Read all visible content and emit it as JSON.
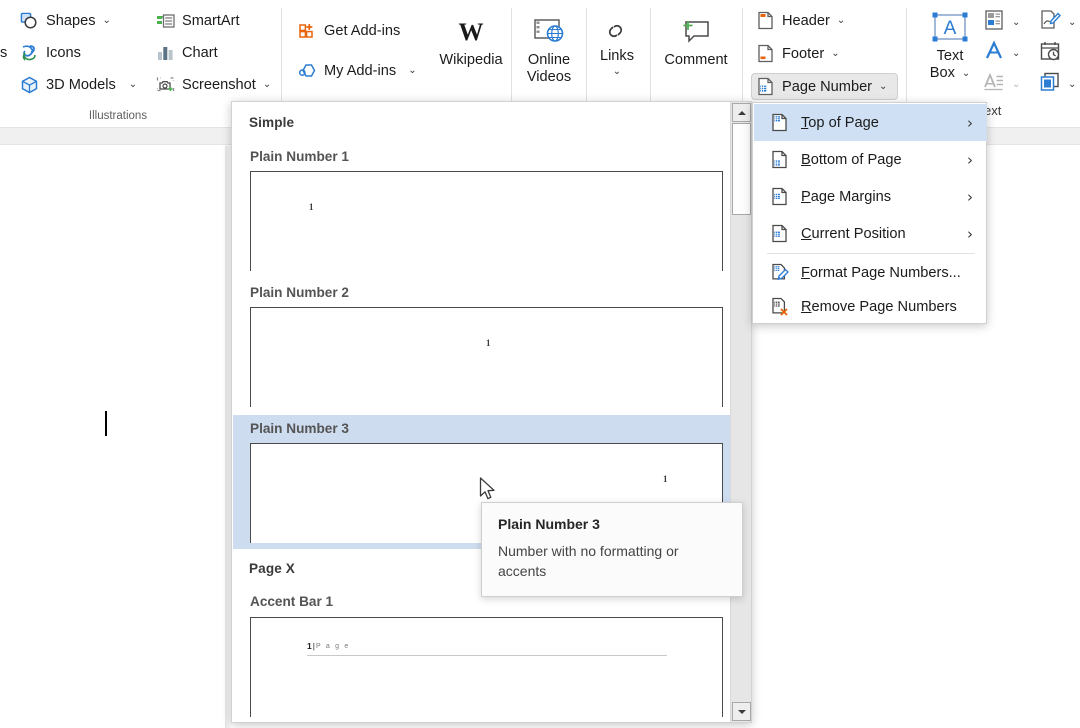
{
  "ribbon": {
    "groups": [
      {
        "name": "illustrations",
        "label": "Illustrations"
      }
    ],
    "illustrations": {
      "shapes": {
        "label": "Shapes",
        "icon": "shapes-icon",
        "chevron": "⌄"
      },
      "icons": {
        "label": "Icons",
        "icon": "icons-icon"
      },
      "models3d": {
        "label": "3D Models",
        "icon": "3d-model-icon",
        "chevron": "⌄"
      },
      "smartart": {
        "label": "SmartArt",
        "icon": "smartart-icon"
      },
      "chart": {
        "label": "Chart",
        "icon": "chart-icon"
      },
      "screenshot": {
        "label": "Screenshot",
        "icon": "screenshot-icon",
        "chevron": "⌄"
      },
      "group_label": "Illustrations"
    },
    "addins": {
      "get_addins": {
        "label": "Get Add-ins",
        "icon": "get-addins-icon"
      },
      "my_addins": {
        "label": "My Add-ins",
        "icon": "my-addins-icon",
        "chevron": "⌄"
      }
    },
    "media": {
      "wikipedia": {
        "label": "Wikipedia",
        "icon": "wikipedia-icon"
      },
      "online_videos": {
        "label_line1": "Online",
        "label_line2": "Videos",
        "icon": "online-videos-icon"
      }
    },
    "links_group": {
      "links": {
        "label": "Links",
        "icon": "links-icon",
        "chevron": "⌄"
      }
    },
    "comments_group": {
      "comment": {
        "label": "Comment",
        "icon": "comment-icon"
      }
    },
    "header_footer": {
      "header": {
        "label": "Header",
        "icon": "header-icon",
        "chevron": "⌄"
      },
      "footer": {
        "label": "Footer",
        "icon": "footer-icon",
        "chevron": "⌄"
      },
      "page_number": {
        "label": "Page Number",
        "icon": "page-number-icon",
        "chevron": "⌄",
        "state": "pressed"
      }
    },
    "text_group": {
      "text_box": {
        "label_line1": "Text",
        "label_line2": "Box",
        "icon": "text-box-icon",
        "chevron": "⌄"
      },
      "quick_parts": {
        "icon": "quick-parts-icon",
        "chevron": "⌄"
      },
      "word_art": {
        "icon": "word-art-icon",
        "chevron": "⌄"
      },
      "drop_cap": {
        "icon": "drop-cap-icon",
        "chevron": "⌄"
      },
      "signature_line": {
        "icon": "signature-line-icon",
        "chevron": "⌄"
      },
      "date_time": {
        "icon": "date-time-icon"
      },
      "object": {
        "icon": "object-icon",
        "chevron": "⌄"
      },
      "clipped_label": "ext"
    }
  },
  "gallery": {
    "name": "page-number-gallery",
    "sections": [
      {
        "heading": "Simple"
      },
      {
        "heading": "Page X"
      }
    ],
    "items": [
      {
        "label": "Plain Number 1",
        "preview_number": "1",
        "align": "left",
        "selected": false
      },
      {
        "label": "Plain Number 2",
        "preview_number": "1",
        "align": "center",
        "selected": false
      },
      {
        "label": "Plain Number 3",
        "preview_number": "1",
        "align": "right",
        "selected": true
      },
      {
        "label": "Accent Bar 1",
        "accent_number": "1",
        "accent_sep": "|",
        "accent_word": "P a g e",
        "selected": false
      }
    ],
    "scrollbar": {
      "up_arrow": "▲",
      "down_arrow": "▼"
    }
  },
  "menu": {
    "name": "page-number-menu",
    "items": [
      {
        "label": "Top of Page",
        "accel": "T",
        "icon": "page-top-number-icon",
        "submenu": true,
        "highlighted": true
      },
      {
        "label": "Bottom of Page",
        "accel": "B",
        "icon": "page-bottom-number-icon",
        "submenu": true,
        "highlighted": false
      },
      {
        "label": "Page Margins",
        "accel": "P",
        "icon": "page-margins-number-icon",
        "submenu": true,
        "highlighted": false
      },
      {
        "label": "Current Position",
        "accel": "C",
        "icon": "current-position-number-icon",
        "submenu": true,
        "highlighted": false
      },
      {
        "label": "Format Page Numbers...",
        "accel": "F",
        "icon": "format-page-numbers-icon",
        "submenu": false,
        "highlighted": false
      },
      {
        "label": "Remove Page Numbers",
        "accel": "R",
        "icon": "remove-page-numbers-icon",
        "submenu": false,
        "highlighted": false
      }
    ],
    "submenu_arrow": "›"
  },
  "tooltip": {
    "title": "Plain Number 3",
    "description": "Number with no formatting or accents"
  },
  "colors": {
    "menu_highlight": "#cfe0f5",
    "gallery_selection": "#cedcf0",
    "accent_blue": "#2b7cd3",
    "accent_orange": "#e8650d",
    "ribbon_bg": "#ffffff"
  }
}
